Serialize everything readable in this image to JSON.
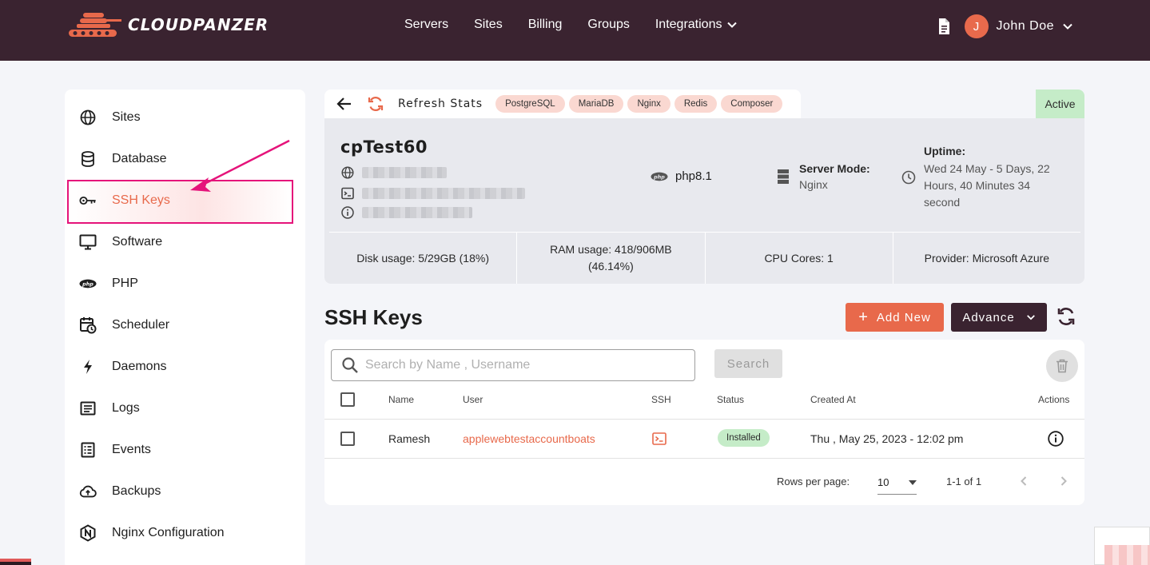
{
  "brand": {
    "name": "CLOUDPANZER"
  },
  "nav": {
    "servers": "Servers",
    "sites": "Sites",
    "billing": "Billing",
    "groups": "Groups",
    "integrations": "Integrations"
  },
  "user": {
    "initial": "J",
    "name": "John Doe"
  },
  "sidebar": {
    "items": [
      {
        "label": "Sites",
        "icon": "globe-icon"
      },
      {
        "label": "Database",
        "icon": "database-icon"
      },
      {
        "label": "SSH Keys",
        "icon": "key-icon"
      },
      {
        "label": "Software",
        "icon": "monitor-icon"
      },
      {
        "label": "PHP",
        "icon": "php-icon"
      },
      {
        "label": "Scheduler",
        "icon": "calendar-clock-icon"
      },
      {
        "label": "Daemons",
        "icon": "bolt-icon"
      },
      {
        "label": "Logs",
        "icon": "logs-icon"
      },
      {
        "label": "Events",
        "icon": "list-icon"
      },
      {
        "label": "Backups",
        "icon": "cloud-upload-icon"
      },
      {
        "label": "Nginx Configuration",
        "icon": "nginx-icon"
      }
    ],
    "active": "SSH Keys"
  },
  "server": {
    "refresh_label": "Refresh Stats",
    "chips": [
      "PostgreSQL",
      "MariaDB",
      "Nginx",
      "Redis",
      "Composer"
    ],
    "status": "Active",
    "name": "cpTest60",
    "php_version": "php8.1",
    "server_mode_label": "Server Mode:",
    "server_mode_value": "Nginx",
    "uptime_label": "Uptime:",
    "uptime_value": "Wed 24 May - 5 Days, 22 Hours, 40 Minutes 34 second",
    "disk_label": "Disk usage:",
    "disk_value": "5/29GB (18%)",
    "ram_label": "RAM usage:",
    "ram_value": "418/906MB (46.14%)",
    "cpu_label": "CPU Cores:",
    "cpu_value": "1",
    "provider_label": "Provider:",
    "provider_value": "Microsoft Azure"
  },
  "ssh": {
    "title": "SSH Keys",
    "add_label": "Add New",
    "advance_label": "Advance",
    "search_placeholder": "Search by Name , Username",
    "search_button": "Search",
    "columns": {
      "name": "Name",
      "user": "User",
      "ssh": "SSH",
      "status": "Status",
      "created": "Created At",
      "actions": "Actions"
    },
    "rows": [
      {
        "name": "Ramesh",
        "user": "applewebtestaccountboats",
        "status": "Installed",
        "created": "Thu , May 25, 2023 - 12:02 pm"
      }
    ],
    "rows_per_page_label": "Rows per page:",
    "rows_per_page_value": "10",
    "range": "1-1 of 1"
  },
  "colors": {
    "accent": "#e8694b",
    "brand_dark": "#3a2330",
    "highlight": "#e5137a"
  }
}
